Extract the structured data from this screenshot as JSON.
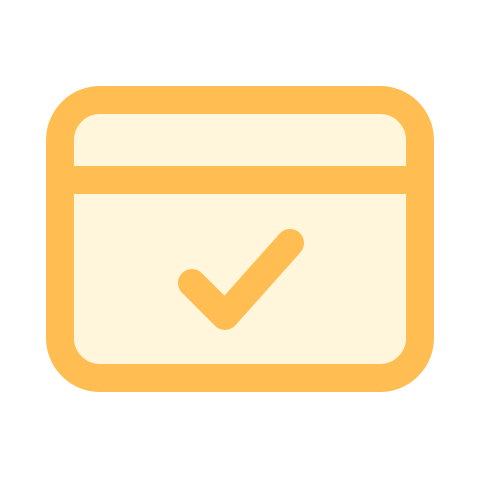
{
  "icon": {
    "name": "browser-window-check-icon",
    "stroke_color": "#FFBD52",
    "fill_color": "#FFF6DC",
    "background": "#FFFFFF"
  }
}
